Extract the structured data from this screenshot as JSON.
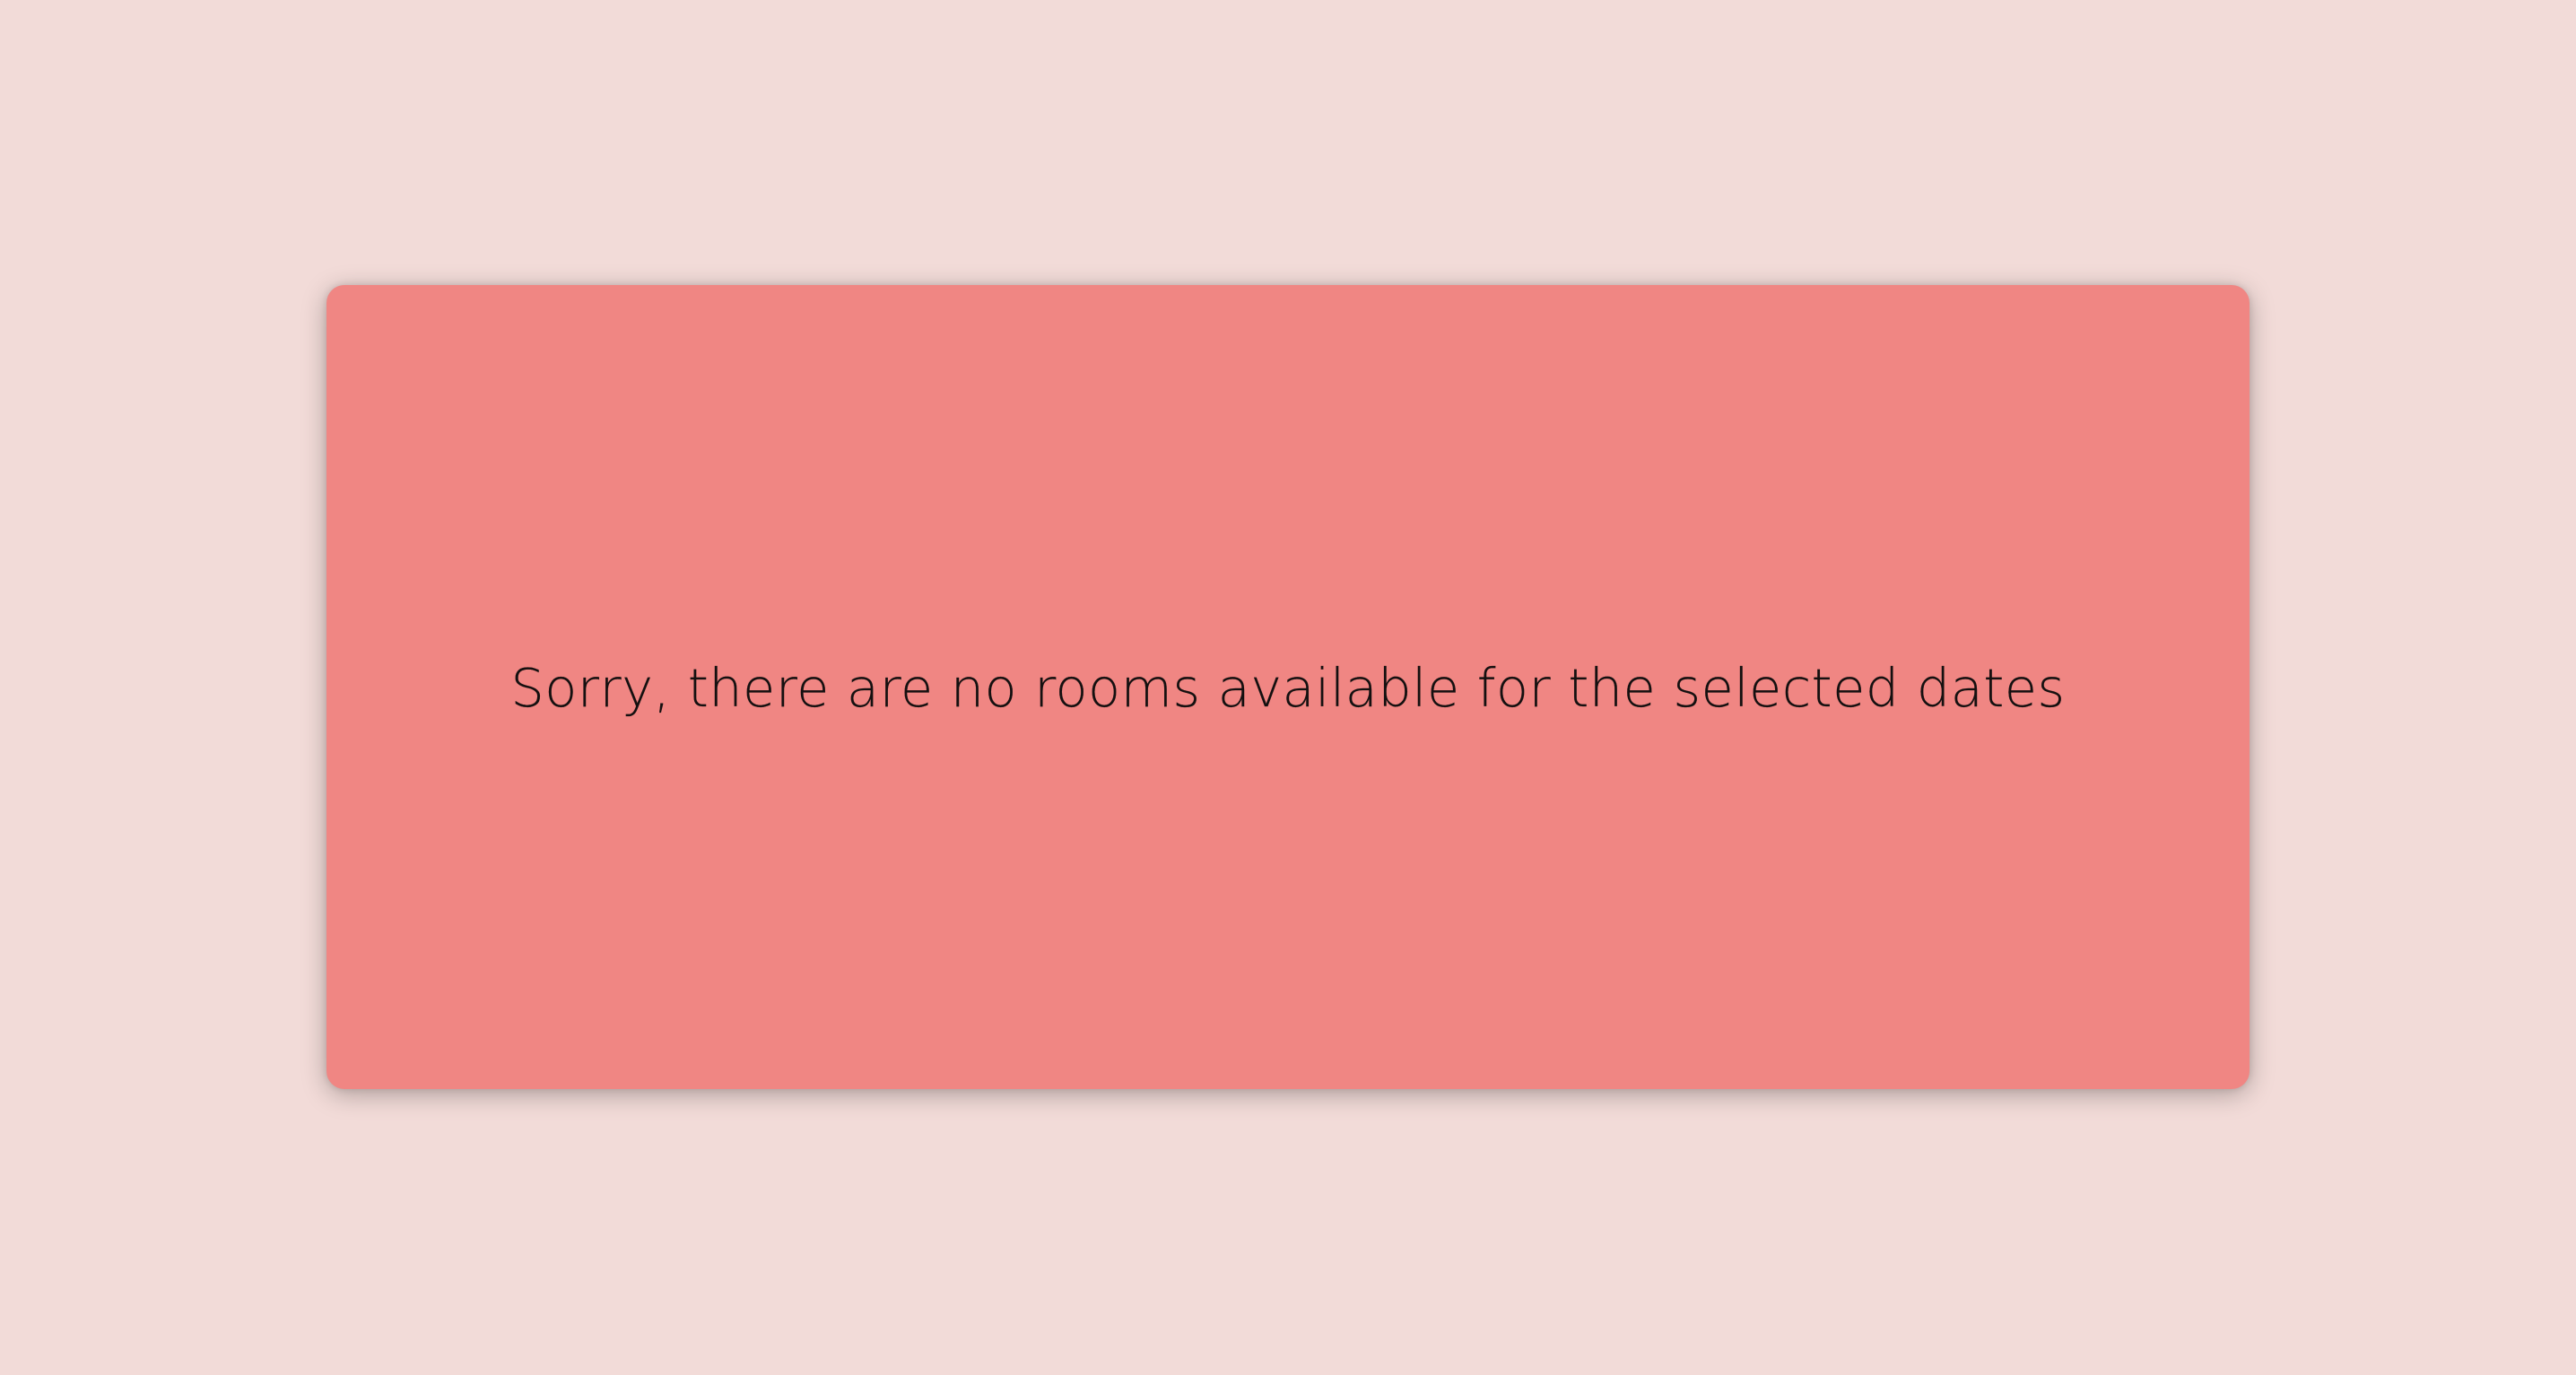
{
  "notice": {
    "message": "Sorry, there are no rooms available for the selected dates"
  },
  "colors": {
    "page_background": "#f2dbd8",
    "card_background": "#f08683",
    "text": "#141010"
  }
}
